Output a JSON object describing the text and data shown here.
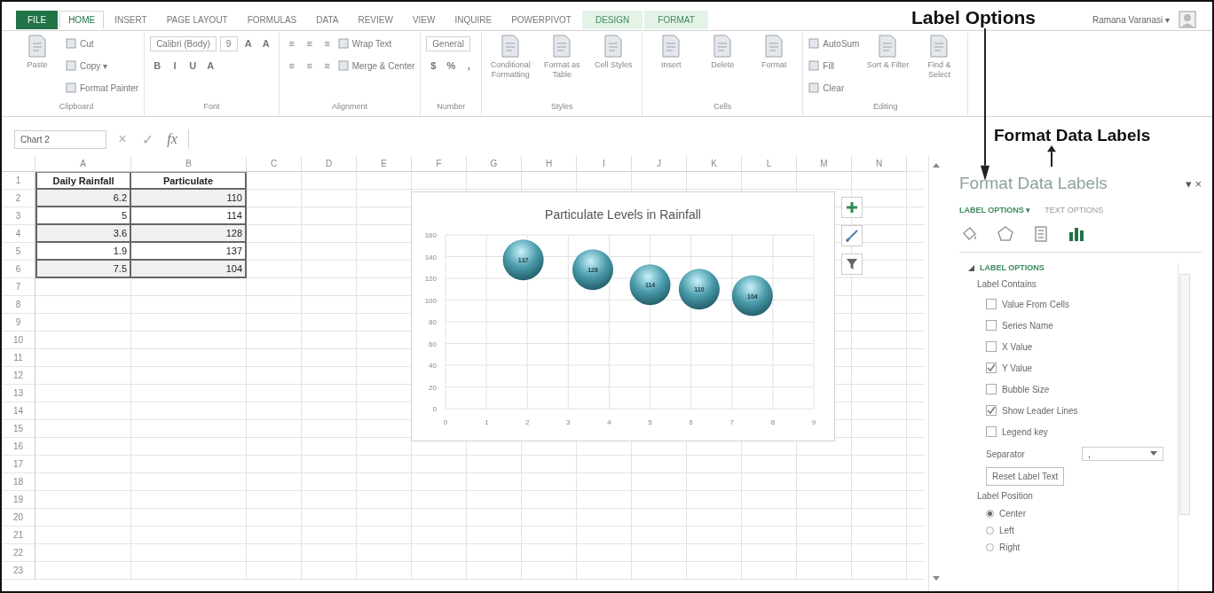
{
  "ribbon": {
    "tabs": [
      {
        "label": "FILE",
        "kind": "file",
        "selected": false
      },
      {
        "label": "HOME",
        "kind": "normal",
        "selected": true
      },
      {
        "label": "INSERT",
        "kind": "normal",
        "selected": false
      },
      {
        "label": "PAGE LAYOUT",
        "kind": "normal",
        "selected": false
      },
      {
        "label": "FORMULAS",
        "kind": "normal",
        "selected": false
      },
      {
        "label": "DATA",
        "kind": "normal",
        "selected": false
      },
      {
        "label": "REVIEW",
        "kind": "normal",
        "selected": false
      },
      {
        "label": "VIEW",
        "kind": "normal",
        "selected": false
      },
      {
        "label": "INQUIRE",
        "kind": "normal",
        "selected": false
      },
      {
        "label": "POWERPIVOT",
        "kind": "normal",
        "selected": false
      },
      {
        "label": "DESIGN",
        "kind": "contextual",
        "selected": false
      },
      {
        "label": "FORMAT",
        "kind": "contextual",
        "selected": false
      }
    ],
    "user": "Ramana Varanasi ▾",
    "groups": [
      {
        "label": "Clipboard",
        "items": [
          {
            "kind": "large",
            "label": "Paste"
          },
          {
            "kind": "stack",
            "lines": [
              {
                "controls": [
                  {
                    "kind": "small",
                    "label": "Cut"
                  }
                ]
              },
              {
                "controls": [
                  {
                    "kind": "small",
                    "label": "Copy ▾"
                  }
                ]
              },
              {
                "controls": [
                  {
                    "kind": "small",
                    "label": "Format Painter"
                  }
                ]
              }
            ]
          }
        ]
      },
      {
        "label": "Font",
        "items": [
          {
            "kind": "stack",
            "lines": [
              {
                "controls": [
                  {
                    "kind": "field",
                    "label": "Calibri (Body)"
                  },
                  {
                    "kind": "field",
                    "label": "9"
                  },
                  {
                    "kind": "glyph",
                    "label": "A"
                  },
                  {
                    "kind": "glyph",
                    "label": "A"
                  }
                ]
              },
              {
                "controls": [
                  {
                    "kind": "glyph",
                    "label": "B"
                  },
                  {
                    "kind": "glyph",
                    "label": "I"
                  },
                  {
                    "kind": "glyph",
                    "label": "U"
                  },
                  {
                    "kind": "glyph",
                    "label": "A"
                  }
                ]
              }
            ]
          }
        ]
      },
      {
        "label": "Alignment",
        "items": [
          {
            "kind": "stack",
            "lines": [
              {
                "controls": [
                  {
                    "kind": "glyph",
                    "label": "≡"
                  },
                  {
                    "kind": "glyph",
                    "label": "≡"
                  },
                  {
                    "kind": "glyph",
                    "label": "≡"
                  },
                  {
                    "kind": "small",
                    "label": "Wrap Text"
                  }
                ]
              },
              {
                "controls": [
                  {
                    "kind": "glyph",
                    "label": "≡"
                  },
                  {
                    "kind": "glyph",
                    "label": "≡"
                  },
                  {
                    "kind": "glyph",
                    "label": "≡"
                  },
                  {
                    "kind": "small",
                    "label": "Merge & Center"
                  }
                ]
              }
            ]
          }
        ]
      },
      {
        "label": "Number",
        "items": [
          {
            "kind": "stack",
            "lines": [
              {
                "controls": [
                  {
                    "kind": "field",
                    "label": "General"
                  }
                ]
              },
              {
                "controls": [
                  {
                    "kind": "glyph",
                    "label": "$"
                  },
                  {
                    "kind": "glyph",
                    "label": "%"
                  },
                  {
                    "kind": "glyph",
                    "label": ","
                  }
                ]
              }
            ]
          }
        ]
      },
      {
        "label": "Styles",
        "items": [
          {
            "kind": "large",
            "label": "Conditional Formatting"
          },
          {
            "kind": "large",
            "label": "Format as Table"
          },
          {
            "kind": "large",
            "label": "Cell Styles"
          }
        ]
      },
      {
        "label": "Cells",
        "items": [
          {
            "kind": "large",
            "label": "Insert"
          },
          {
            "kind": "large",
            "label": "Delete"
          },
          {
            "kind": "large",
            "label": "Format"
          }
        ]
      },
      {
        "label": "Editing",
        "items": [
          {
            "kind": "stack",
            "lines": [
              {
                "controls": [
                  {
                    "kind": "small",
                    "label": "AutoSum"
                  }
                ]
              },
              {
                "controls": [
                  {
                    "kind": "small",
                    "label": "Fill"
                  }
                ]
              },
              {
                "controls": [
                  {
                    "kind": "small",
                    "label": "Clear"
                  }
                ]
              }
            ]
          },
          {
            "kind": "large",
            "label": "Sort & Filter"
          },
          {
            "kind": "large",
            "label": "Find & Select"
          }
        ]
      }
    ]
  },
  "formula_bar": {
    "name_box": "Chart 2",
    "cancel": "×",
    "enter": "✓",
    "function": "fx"
  },
  "sheet": {
    "columns": [
      "A",
      "B",
      "C",
      "D",
      "E",
      "F",
      "G",
      "H",
      "I",
      "J",
      "K",
      "L",
      "M",
      "N"
    ],
    "row_numbers": [
      "1",
      "2",
      "3",
      "4",
      "5",
      "6",
      "7",
      "8",
      "9",
      "10",
      "11",
      "12",
      "13",
      "14",
      "15",
      "16",
      "17",
      "18",
      "19",
      "20",
      "21",
      "22",
      "23"
    ],
    "table": {
      "header": [
        "Daily Rainfall",
        "Particulate"
      ],
      "rows": [
        [
          "6.2",
          "110"
        ],
        [
          "5",
          "114"
        ],
        [
          "3.6",
          "128"
        ],
        [
          "1.9",
          "137"
        ],
        [
          "7.5",
          "104"
        ]
      ]
    }
  },
  "chart": {
    "chart_data": {
      "type": "scatter",
      "title": "Particulate Levels in Rainfall",
      "x": [
        6.2,
        5,
        3.6,
        1.9,
        7.5
      ],
      "series": [
        {
          "color": "#4a9bab",
          "values": [
            110,
            114,
            128,
            137,
            104
          ]
        }
      ],
      "grid": true,
      "xlim": [
        0,
        9
      ],
      "ylim": [
        0,
        160
      ],
      "xticks": [
        0,
        1,
        2,
        3,
        4,
        5,
        6,
        7,
        8,
        9
      ],
      "yticks": [
        0,
        20,
        40,
        60,
        80,
        100,
        120,
        140,
        160
      ],
      "data_labels": true
    }
  },
  "panel": {
    "title": "Format Data Labels",
    "controls": "▾ ×",
    "tabs": [
      {
        "label": "LABEL OPTIONS ▾",
        "selected": true
      },
      {
        "label": "TEXT OPTIONS",
        "selected": false
      }
    ],
    "icon_tabs": [
      {
        "kind": "fill",
        "selected": false
      },
      {
        "kind": "effects",
        "selected": false
      },
      {
        "kind": "size",
        "selected": false
      },
      {
        "kind": "options",
        "selected": true
      }
    ],
    "section": {
      "label": "LABEL OPTIONS",
      "expanded": true
    },
    "label_contains": "Label Contains",
    "checkboxes": [
      {
        "label": "Value From Cells",
        "checked": false
      },
      {
        "label": "Series Name",
        "checked": false
      },
      {
        "label": "X Value",
        "checked": false
      },
      {
        "label": "Y Value",
        "checked": true
      },
      {
        "label": "Bubble Size",
        "checked": false
      },
      {
        "label": "Show Leader Lines",
        "checked": true
      },
      {
        "label": "Legend key",
        "checked": false
      }
    ],
    "separator": {
      "label": "Separator",
      "value": ","
    },
    "reset_button": "Reset Label Text",
    "label_position": "Label Position",
    "radios": [
      {
        "label": "Center",
        "selected": true
      },
      {
        "label": "Left",
        "selected": false
      },
      {
        "label": "Right",
        "selected": false
      }
    ]
  },
  "annotations": [
    {
      "text": "Label Options",
      "kind": "arrow_down"
    },
    {
      "text": "Format Data Labels",
      "kind": "arrow_up"
    }
  ]
}
